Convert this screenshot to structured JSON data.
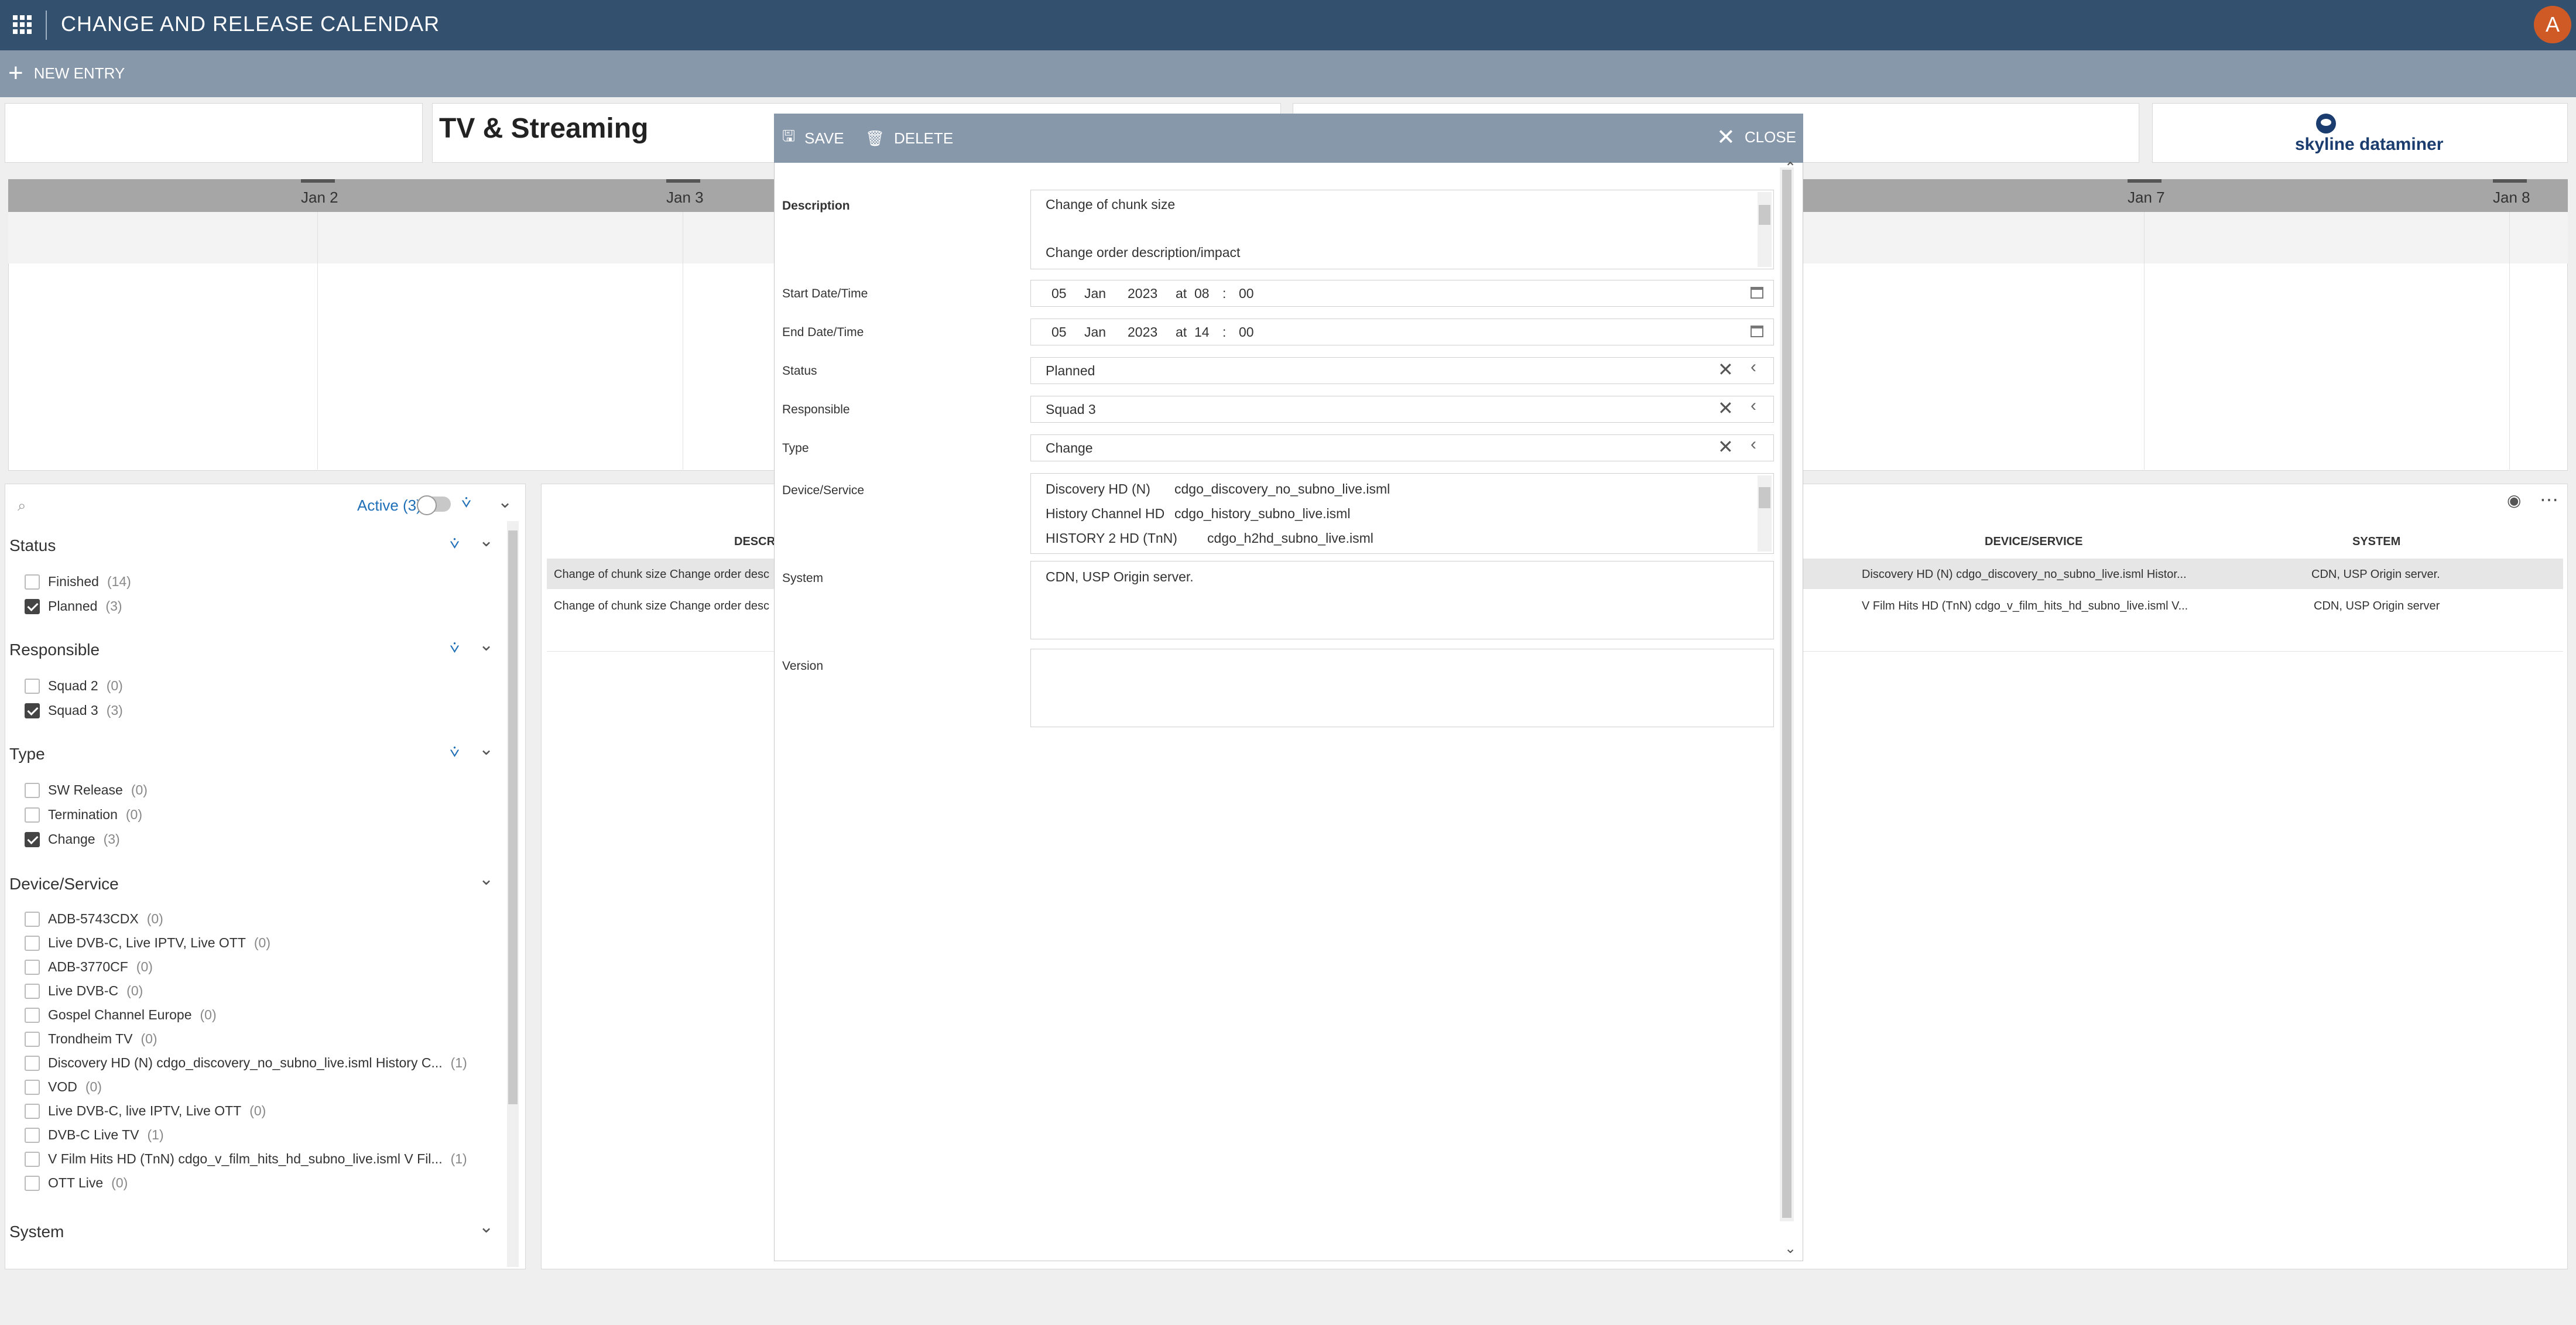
{
  "topbar": {
    "title": "CHANGE AND RELEASE CALENDAR",
    "avatar_initial": "A"
  },
  "subbar": {
    "new_entry_label": "NEW ENTRY"
  },
  "header": {
    "brand_title": "TV & Streaming",
    "logo_left": "skyline",
    "logo_right": "dataminer"
  },
  "timeline": {
    "dates": [
      "Jan 2",
      "Jan 3",
      "Jan 7",
      "Jan 8"
    ]
  },
  "filters": {
    "search_icon": "search-icon",
    "active_label": "Active (3)",
    "status": {
      "title": "Status",
      "items": [
        {
          "label": "Finished",
          "count": "(14)",
          "checked": false
        },
        {
          "label": "Planned",
          "count": "(3)",
          "checked": true
        }
      ]
    },
    "responsible": {
      "title": "Responsible",
      "items": [
        {
          "label": "Squad 2",
          "count": "(0)",
          "checked": false
        },
        {
          "label": "Squad 3",
          "count": "(3)",
          "checked": true
        }
      ]
    },
    "type": {
      "title": "Type",
      "items": [
        {
          "label": "SW Release",
          "count": "(0)",
          "checked": false
        },
        {
          "label": "Termination",
          "count": "(0)",
          "checked": false
        },
        {
          "label": "Change",
          "count": "(3)",
          "checked": true
        }
      ]
    },
    "device": {
      "title": "Device/Service",
      "items": [
        {
          "label": "ADB-5743CDX",
          "count": "(0)"
        },
        {
          "label": "Live DVB-C, Live IPTV, Live OTT",
          "count": "(0)"
        },
        {
          "label": "ADB-3770CF",
          "count": "(0)"
        },
        {
          "label": "Live DVB-C",
          "count": "(0)"
        },
        {
          "label": "Gospel Channel Europe",
          "count": "(0)"
        },
        {
          "label": "Trondheim TV",
          "count": "(0)"
        },
        {
          "label": "Discovery HD (N) cdgo_discovery_no_subno_live.isml History C...",
          "count": "(1)"
        },
        {
          "label": "VOD",
          "count": "(0)"
        },
        {
          "label": "Live DVB-C, live IPTV, Live OTT",
          "count": "(0)"
        },
        {
          "label": "DVB-C Live TV",
          "count": "(1)"
        },
        {
          "label": "V Film Hits HD (TnN) cdgo_v_film_hits_hd_subno_live.isml V Fil...",
          "count": "(1)"
        },
        {
          "label": "OTT Live",
          "count": "(0)"
        }
      ]
    },
    "system": {
      "title": "System"
    }
  },
  "table": {
    "columns": {
      "description": "DESCRI",
      "device": "DEVICE/SERVICE",
      "system": "SYSTEM"
    },
    "rows": [
      {
        "description": "Change of chunk size Change order desc",
        "device": "Discovery HD (N) cdgo_discovery_no_subno_live.isml Histor...",
        "system": "CDN, USP Origin server."
      },
      {
        "description": "Change of chunk size Change order desc",
        "device": "V Film Hits HD (TnN) cdgo_v_film_hits_hd_subno_live.isml V...",
        "system": "CDN, USP Origin server"
      }
    ]
  },
  "modal": {
    "save_label": "SAVE",
    "delete_label": "DELETE",
    "close_label": "CLOSE",
    "labels": {
      "description": "Description",
      "start": "Start Date/Time",
      "end": "End Date/Time",
      "status": "Status",
      "responsible": "Responsible",
      "type": "Type",
      "device": "Device/Service",
      "system": "System",
      "version": "Version"
    },
    "description_line1": "Change of chunk size",
    "description_line2": "Change order description/impact",
    "start": {
      "day": "05",
      "month": "Jan",
      "year": "2023",
      "at": "at",
      "hour": "08",
      "sep": ":",
      "minute": "00"
    },
    "end": {
      "day": "05",
      "month": "Jan",
      "year": "2023",
      "at": "at",
      "hour": "14",
      "sep": ":",
      "minute": "00"
    },
    "status_value": "Planned",
    "responsible_value": "Squad 3",
    "type_value": "Change",
    "devices": [
      {
        "name": "Discovery HD (N)",
        "file": "cdgo_discovery_no_subno_live.isml"
      },
      {
        "name": "History Channel HD",
        "file": "cdgo_history_subno_live.isml"
      },
      {
        "name": "HISTORY 2 HD (TnN)",
        "file": "cdgo_h2hd_subno_live.isml"
      }
    ],
    "system_value": "CDN, USP Origin server.",
    "version_value": ""
  }
}
